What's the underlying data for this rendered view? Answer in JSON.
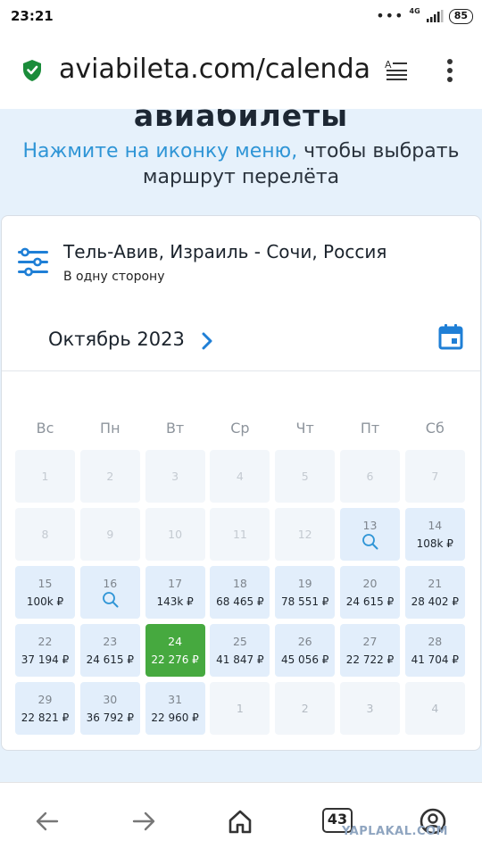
{
  "status": {
    "time": "23:21",
    "dots": "•••",
    "network": "4G",
    "battery": "85"
  },
  "browser": {
    "url": "aviabileta.com/calendar"
  },
  "page": {
    "heading_partial": "авиабилеты",
    "hint_accent": "Нажмите на иконку меню,",
    "hint_rest": " чтобы выбрать маршрут перелёта"
  },
  "route": {
    "title": "Тель-Авив, Израиль - Сочи, Россия",
    "subtitle": "В одну сторону"
  },
  "calendar": {
    "month": "Октябрь 2023",
    "weekdays": [
      "Вс",
      "Пн",
      "Вт",
      "Ср",
      "Чт",
      "Пт",
      "Сб"
    ],
    "weeks": [
      [
        {
          "day": "1",
          "state": "disabled"
        },
        {
          "day": "2",
          "state": "disabled"
        },
        {
          "day": "3",
          "state": "disabled"
        },
        {
          "day": "4",
          "state": "disabled"
        },
        {
          "day": "5",
          "state": "disabled"
        },
        {
          "day": "6",
          "state": "disabled"
        },
        {
          "day": "7",
          "state": "disabled"
        }
      ],
      [
        {
          "day": "8",
          "state": "disabled"
        },
        {
          "day": "9",
          "state": "disabled"
        },
        {
          "day": "10",
          "state": "disabled"
        },
        {
          "day": "11",
          "state": "disabled"
        },
        {
          "day": "12",
          "state": "disabled"
        },
        {
          "day": "13",
          "state": "search"
        },
        {
          "day": "14",
          "state": "price",
          "price": "108k ₽"
        }
      ],
      [
        {
          "day": "15",
          "state": "price",
          "price": "100k ₽"
        },
        {
          "day": "16",
          "state": "search"
        },
        {
          "day": "17",
          "state": "price",
          "price": "143k ₽"
        },
        {
          "day": "18",
          "state": "price",
          "price": "68 465 ₽"
        },
        {
          "day": "19",
          "state": "price",
          "price": "78 551 ₽"
        },
        {
          "day": "20",
          "state": "price",
          "price": "24 615 ₽"
        },
        {
          "day": "21",
          "state": "price",
          "price": "28 402 ₽"
        }
      ],
      [
        {
          "day": "22",
          "state": "price",
          "price": "37 194 ₽"
        },
        {
          "day": "23",
          "state": "price",
          "price": "24 615 ₽"
        },
        {
          "day": "24",
          "state": "selected",
          "price": "22 276 ₽"
        },
        {
          "day": "25",
          "state": "price",
          "price": "41 847 ₽"
        },
        {
          "day": "26",
          "state": "price",
          "price": "45 056 ₽"
        },
        {
          "day": "27",
          "state": "price",
          "price": "22 722 ₽"
        },
        {
          "day": "28",
          "state": "price",
          "price": "41 704 ₽"
        }
      ],
      [
        {
          "day": "29",
          "state": "price",
          "price": "22 821 ₽"
        },
        {
          "day": "30",
          "state": "price",
          "price": "36 792 ₽"
        },
        {
          "day": "31",
          "state": "price",
          "price": "22 960 ₽"
        },
        {
          "day": "1",
          "state": "next"
        },
        {
          "day": "2",
          "state": "next"
        },
        {
          "day": "3",
          "state": "next"
        },
        {
          "day": "4",
          "state": "next"
        }
      ]
    ]
  },
  "nav": {
    "tabs_count": "43",
    "watermark": "YAPLAKAL.COM"
  },
  "colors": {
    "accent": "#2f95d6",
    "selected": "#46a93f",
    "page_bg": "#e6f1fb",
    "icon_blue": "#1f7fd6"
  }
}
